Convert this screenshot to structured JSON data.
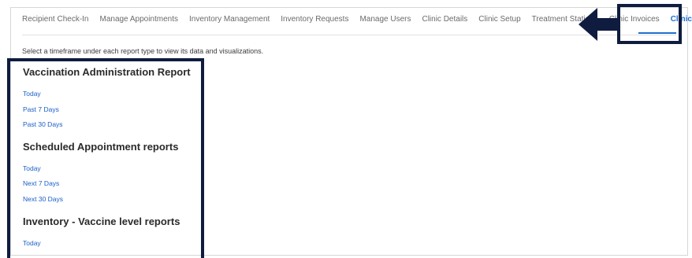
{
  "tabs": [
    {
      "label": "Recipient Check-In"
    },
    {
      "label": "Manage Appointments"
    },
    {
      "label": "Inventory Management"
    },
    {
      "label": "Inventory Requests"
    },
    {
      "label": "Manage Users"
    },
    {
      "label": "Clinic Details"
    },
    {
      "label": "Clinic Setup"
    },
    {
      "label": "Treatment Stations"
    },
    {
      "label": "Clinic Invoices"
    },
    {
      "label": "Clinic Data"
    }
  ],
  "active_tab": "Clinic Data",
  "instruction": "Select a timeframe under each report type to view its data and visualizations.",
  "sections": [
    {
      "title": "Vaccination Administration Report",
      "links": [
        "Today",
        "Past 7 Days",
        "Past 30 Days"
      ]
    },
    {
      "title": "Scheduled Appointment reports",
      "links": [
        "Today",
        "Next 7 Days",
        "Next 30 Days"
      ]
    },
    {
      "title": "Inventory - Vaccine level reports",
      "links": [
        "Today"
      ]
    }
  ],
  "colors": {
    "accent": "#1f6fcf",
    "link": "#1a5fc7",
    "highlight": "#0f1c3f"
  }
}
